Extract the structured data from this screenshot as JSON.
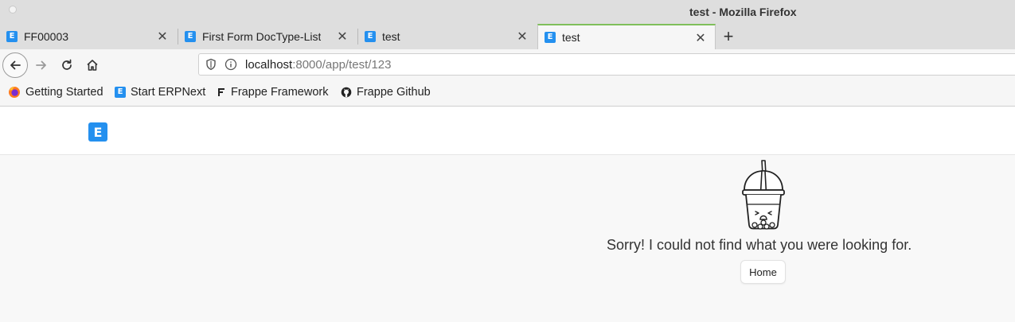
{
  "window": {
    "title": "test - Mozilla Firefox"
  },
  "tabs": [
    {
      "label": "FF00003",
      "active": false
    },
    {
      "label": "First Form DocType-List",
      "active": false
    },
    {
      "label": "test",
      "active": false
    },
    {
      "label": "test",
      "active": true
    }
  ],
  "tab_close_glyph": "✕",
  "new_tab_glyph": "+",
  "favicon_letter": "E",
  "address": {
    "host": "localhost",
    "path": ":8000/app/test/123"
  },
  "bookmarks": [
    {
      "label": "Getting Started",
      "icon": "firefox-icon"
    },
    {
      "label": "Start ERPNext",
      "icon": "erpnext-icon"
    },
    {
      "label": "Frappe Framework",
      "icon": "frappe-icon"
    },
    {
      "label": "Frappe Github",
      "icon": "github-icon"
    }
  ],
  "app": {
    "logo_letter": "E"
  },
  "not_found": {
    "message": "Sorry! I could not find what you were looking for.",
    "home_button": "Home"
  },
  "colors": {
    "accent": "#2490ef",
    "active_tab_line": "#7fbf5a"
  }
}
